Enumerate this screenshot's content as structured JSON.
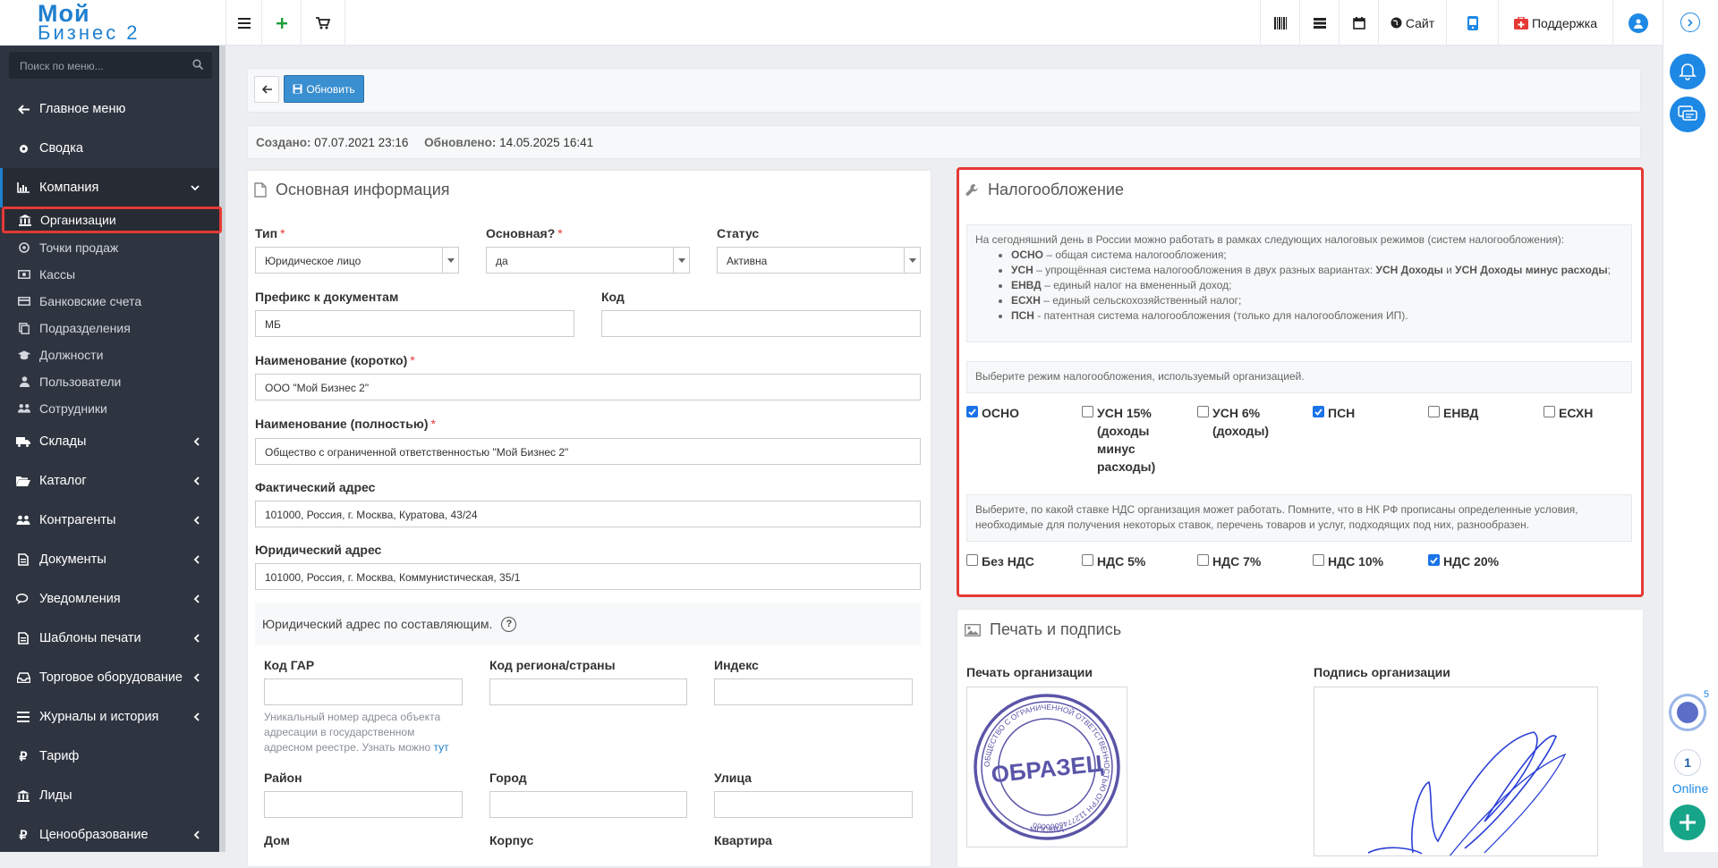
{
  "app": {
    "logo_line1": "Мой",
    "logo_line2": "Бизнес 2"
  },
  "topbar": {
    "site_label": "Сайт",
    "support_label": "Поддержка"
  },
  "sidebar": {
    "search_placeholder": "Поиск по меню...",
    "items": [
      {
        "label": "Главное меню"
      },
      {
        "label": "Сводка"
      },
      {
        "label": "Компания"
      },
      {
        "label": "Склады"
      },
      {
        "label": "Каталог"
      },
      {
        "label": "Контрагенты"
      },
      {
        "label": "Документы"
      },
      {
        "label": "Уведомления"
      },
      {
        "label": "Шаблоны печати"
      },
      {
        "label": "Торговое оборудование"
      },
      {
        "label": "Журналы и история"
      },
      {
        "label": "Тариф"
      },
      {
        "label": "Лиды"
      },
      {
        "label": "Ценообразование"
      }
    ],
    "company_sub": [
      {
        "label": "Организации"
      },
      {
        "label": "Точки продаж"
      },
      {
        "label": "Кассы"
      },
      {
        "label": "Банковские счета"
      },
      {
        "label": "Подразделения"
      },
      {
        "label": "Должности"
      },
      {
        "label": "Пользователи"
      },
      {
        "label": "Сотрудники"
      }
    ]
  },
  "toolbar": {
    "refresh_label": "Обновить"
  },
  "meta": {
    "created_label": "Создано:",
    "created_value": "07.07.2021 23:16",
    "updated_label": "Обновлено:",
    "updated_value": "14.05.2025 16:41"
  },
  "main_info": {
    "title": "Основная информация",
    "type_label": "Тип",
    "type_value": "Юридическое лицо",
    "primary_label": "Основная?",
    "primary_value": "да",
    "status_label": "Статус",
    "status_value": "Активна",
    "prefix_label": "Префикс к документам",
    "prefix_value": "МБ",
    "code_label": "Код",
    "code_value": "",
    "short_name_label": "Наименование (коротко)",
    "short_name_value": "ООО \"Мой Бизнес 2\"",
    "full_name_label": "Наименование (полностью)",
    "full_name_value": "Общество с ограниченной ответственностью \"Мой Бизнес 2\"",
    "actual_address_label": "Фактический адрес",
    "actual_address_value": "101000, Россия, г. Москва, Куратова, 43/24",
    "legal_address_label": "Юридический адрес",
    "legal_address_value": "101000, Россия, г. Москва, Коммунистическая, 35/1",
    "components_title": "Юридический адрес по составляющим.",
    "gar_label": "Код ГАР",
    "region_label": "Код региона/страны",
    "index_label": "Индекс",
    "gar_hint": "Уникальный номер адреса объекта адресации в государственном адресном реестре. Узнать можно",
    "gar_hint_link": "тут",
    "district_label": "Район",
    "city_label": "Город",
    "street_label": "Улица",
    "house_label": "Дом",
    "building_label": "Корпус",
    "apartment_label": "Квартира"
  },
  "tax": {
    "title": "Налогообложение",
    "intro": "На сегодняшний день в России можно работать в рамках следующих налоговых режимов (систем налогообложения):",
    "regimes": [
      {
        "abbr": "ОСНО",
        "text": " – общая система налогообложения;"
      },
      {
        "abbr": "УСН",
        "text": " – упрощённая система налогообложения в двух разных вариантах: ",
        "b1": "УСН Доходы",
        "mid": " и ",
        "b2": "УСН Доходы минус расходы",
        "end": ";"
      },
      {
        "abbr": "ЕНВД",
        "text": " – единый налог на вмененный доход;"
      },
      {
        "abbr": "ЕСХН",
        "text": " – единый сельскохозяйственный налог;"
      },
      {
        "abbr": "ПСН",
        "text": " - патентная система налогообложения (только для налогообложения ИП)."
      }
    ],
    "choose_regime": "Выберите режим налогообложения, используемый организацией.",
    "regime_options": [
      {
        "label": "ОСНО",
        "checked": true
      },
      {
        "label": "УСН 15% (доходы минус расходы)",
        "checked": false
      },
      {
        "label": "УСН 6% (доходы)",
        "checked": false
      },
      {
        "label": "ПСН",
        "checked": true
      },
      {
        "label": "ЕНВД",
        "checked": false
      },
      {
        "label": "ЕСХН",
        "checked": false
      }
    ],
    "vat_hint": "Выберите, по какой ставке НДС организация может работать. Помните, что в НК РФ прописаны определенные условия, необходимые для получения некоторых ставок, перечень товаров и услуг, подходящих под них, разнообразен.",
    "vat_options": [
      {
        "label": "Без НДС",
        "checked": false
      },
      {
        "label": "НДС 5%",
        "checked": false
      },
      {
        "label": "НДС 7%",
        "checked": false
      },
      {
        "label": "НДС 10%",
        "checked": false
      },
      {
        "label": "НДС 20%",
        "checked": true
      }
    ]
  },
  "stamp": {
    "title": "Печать и подпись",
    "stamp_label": "Печать организации",
    "signature_label": "Подпись организации",
    "stamp_center": "ОБРАЗЕЦ",
    "stamp_bottom": "МОСКВА",
    "stamp_ring": "ОБЩЕСТВО С ОГРАНИЧЕННОЙ ОТВЕТСТВЕННОСТЬЮ ОГРН 1127746000000"
  },
  "rightbar": {
    "badge_count": "5",
    "online_count": "1",
    "online_label": "Online"
  },
  "colors": {
    "accent": "#1f7fcf",
    "sidebar": "#2f3540",
    "highlight": "#e53935",
    "button": "#3a8fd0"
  }
}
